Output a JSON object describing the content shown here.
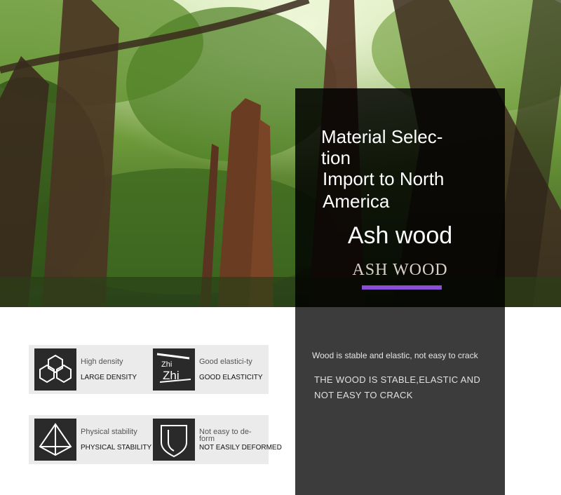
{
  "hero": {
    "title_lines": [
      "Material Selec-",
      "tion",
      "Import to North",
      "America"
    ],
    "wood_name": "Ash wood",
    "wood_name_en": "ASH WOOD",
    "accent_color": "#8a4fd6"
  },
  "description": {
    "cn": "Wood is stable and elastic, not easy to crack",
    "en": "THE WOOD IS STABLE,ELASTIC AND NOT EASY TO CRACK"
  },
  "features": [
    {
      "icon": "hexagon-cluster-icon",
      "cn": "High density",
      "en": "LARGE DENSITY"
    },
    {
      "icon": "elasticity-glyph-icon",
      "icon_text": "Zhi",
      "cn": "Good elastici-ty",
      "en": "GOOD ELASTICITY"
    },
    {
      "icon": "pyramid-icon",
      "cn": "Physical stability",
      "en": "PHYSICAL STABILITY"
    },
    {
      "icon": "shield-icon",
      "cn": "Not easy to de-form",
      "en": "NOT EASILY DEFORMED"
    }
  ]
}
